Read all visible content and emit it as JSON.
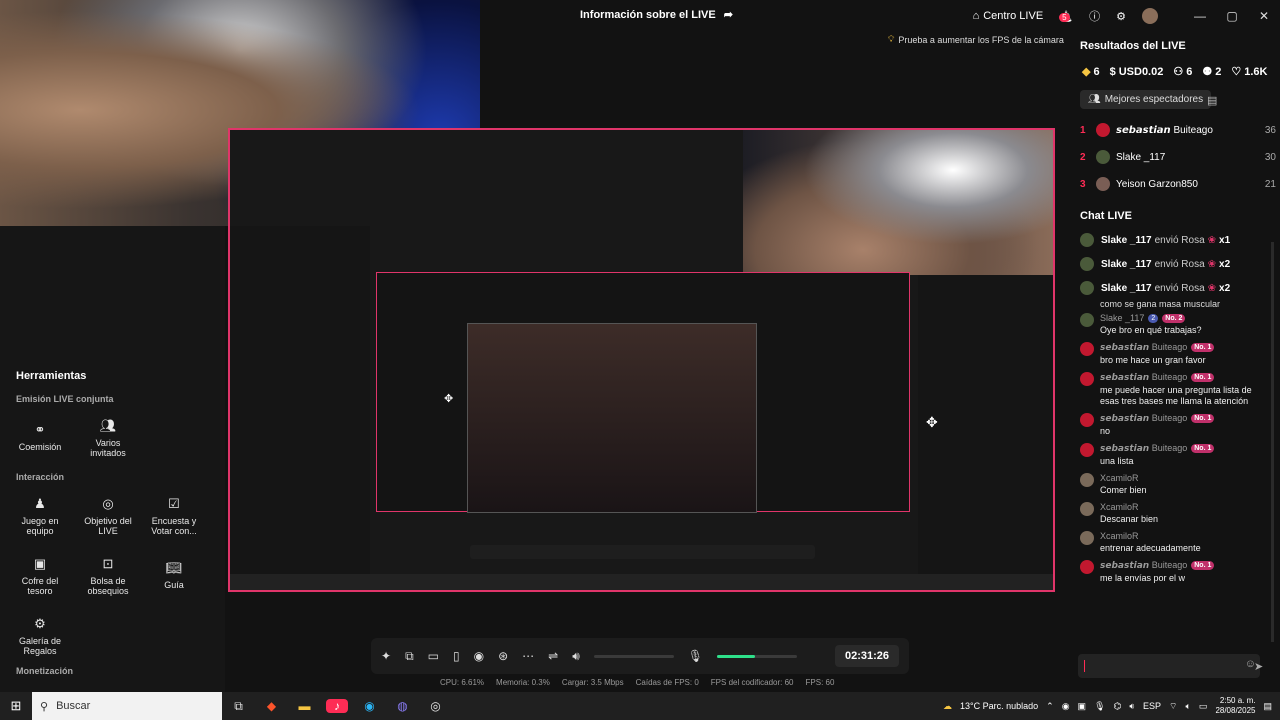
{
  "topbar": {
    "title": "Información sobre el LIVE",
    "share_icon": "share-icon",
    "center_live": "Centro LIVE",
    "notif_count": "5",
    "window_controls": [
      "—",
      "▢",
      "✕"
    ]
  },
  "tip": "Prueba a aumentar los FPS de la cámara",
  "tools": {
    "title": "Herramientas",
    "section_1": "Emisión LIVE conjunta",
    "coemision": "Coemisión",
    "varios_invitados": "Varios invitados",
    "section_2": "Interacción",
    "juego_equipo": "Juego en equipo",
    "objetivo_live": "Objetivo del LIVE",
    "encuesta": "Encuesta y Votar con...",
    "cofre": "Cofre del tesoro",
    "bolsa": "Bolsa de obsequios",
    "guia": "Guía",
    "galeria": "Galería de Regalos",
    "section_3": "Monetización"
  },
  "controls": {
    "timer": "02:31:26",
    "volume_level": 0.0,
    "mic_level": 0.47
  },
  "stats": {
    "cpu": "CPU:  6.61%",
    "memoria": "Memoria:  0.3%",
    "cargar": "Cargar:  3.5 Mbps",
    "caidas": "Caídas de FPS:  0",
    "fps_cod": "FPS del codificador:  60",
    "fps": "FPS:  60"
  },
  "results": {
    "title": "Resultados del LIVE",
    "diamonds": "6",
    "usd": "USD0.02",
    "viewers": "6",
    "followers": "2",
    "likes": "1.6K",
    "best_button": "Mejores espectadores",
    "ranking": [
      {
        "rank": "1",
        "name": "𝙨𝙚𝙗𝙖𝙨𝙩𝙞𝙖𝙣 Buiteago",
        "score": "36",
        "color": "#c2182f"
      },
      {
        "rank": "2",
        "name": "Slake _117",
        "score": "30",
        "color": "#4a5a3a"
      },
      {
        "rank": "3",
        "name": "Yeison Garzon850",
        "score": "21",
        "color": "#7a5e55"
      }
    ]
  },
  "chat": {
    "title": "Chat LIVE",
    "gifts": [
      {
        "user": "Slake _117",
        "action": "envió Rosa",
        "mult": "x1"
      },
      {
        "user": "Slake _117",
        "action": "envió Rosa",
        "mult": "x2"
      },
      {
        "user": "Slake _117",
        "action": "envió Rosa",
        "mult": "x2"
      }
    ],
    "cut_line": "como se gana masa muscular",
    "messages": [
      {
        "user": "Slake _117",
        "badge": "No. 2",
        "level": "2",
        "text": "Oye bro en qué trabajas?",
        "color": "#4a5a3a"
      },
      {
        "user": "𝙨𝙚𝙗𝙖𝙨𝙩𝙞𝙖𝙣 Buiteago",
        "badge": "No. 1",
        "text": "bro me hace un gran favor",
        "color": "#c2182f"
      },
      {
        "user": "𝙨𝙚𝙗𝙖𝙨𝙩𝙞𝙖𝙣 Buiteago",
        "badge": "No. 1",
        "text": "me puede hacer una pregunta lista de esas tres bases me llama la atención",
        "color": "#c2182f"
      },
      {
        "user": "𝙨𝙚𝙗𝙖𝙨𝙩𝙞𝙖𝙣 Buiteago",
        "badge": "No. 1",
        "text": "no",
        "color": "#c2182f"
      },
      {
        "user": "𝙨𝙚𝙗𝙖𝙨𝙩𝙞𝙖𝙣 Buiteago",
        "badge": "No. 1",
        "text": "una lista",
        "color": "#c2182f"
      },
      {
        "user": "XcamiloR",
        "badge": "",
        "text": "Comer bien",
        "color": "#7a6a5a"
      },
      {
        "user": "XcamiloR",
        "badge": "",
        "text": "Descanar bien",
        "color": "#7a6a5a"
      },
      {
        "user": "XcamiloR",
        "badge": "",
        "text": "entrenar adecuadamente",
        "color": "#7a6a5a"
      },
      {
        "user": "𝙨𝙚𝙗𝙖𝙨𝙩𝙞𝙖𝙣 Buiteago",
        "badge": "No. 1",
        "text": "me la envías por el w",
        "color": "#c2182f"
      }
    ]
  },
  "taskbar": {
    "search_placeholder": "Buscar",
    "weather": "13°C  Parc. nublado",
    "lang": "ESP",
    "time": "2:50 a. m.",
    "date": "28/08/2025"
  }
}
